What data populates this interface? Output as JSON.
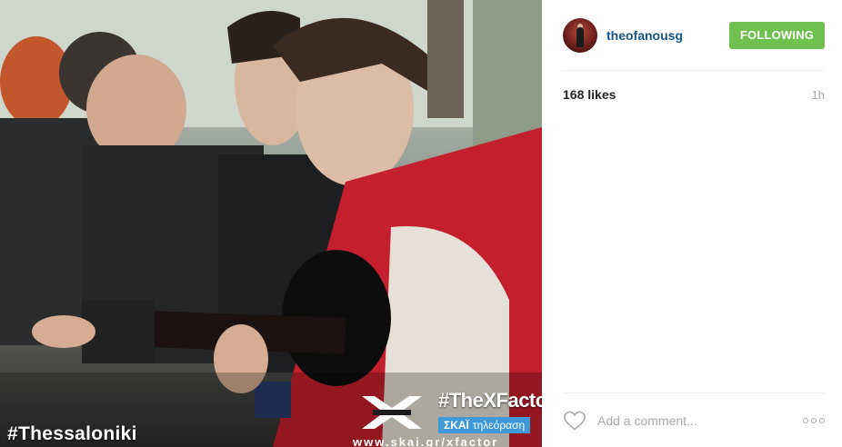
{
  "photo": {
    "overlay_tag": "#Thessaloniki",
    "show_logo_text": "X FACTOR",
    "show_hashtag": "#TheXFactor",
    "channel_name": "ΣΚΑΪ",
    "channel_sub": "τηλεόραση",
    "channel_url": "www.skai.gr/xfactor"
  },
  "post": {
    "username": "theofanousg",
    "follow_label": "FOLLOWING",
    "likes": "168 likes",
    "time": "1h",
    "comment_placeholder": "Add a comment...",
    "icons": {
      "avatar": "avatar",
      "like": "heart-icon",
      "more": "more-options-icon"
    },
    "colors": {
      "username": "#125688",
      "follow_button": "#70c050",
      "muted_text": "#a5a7aa"
    }
  }
}
